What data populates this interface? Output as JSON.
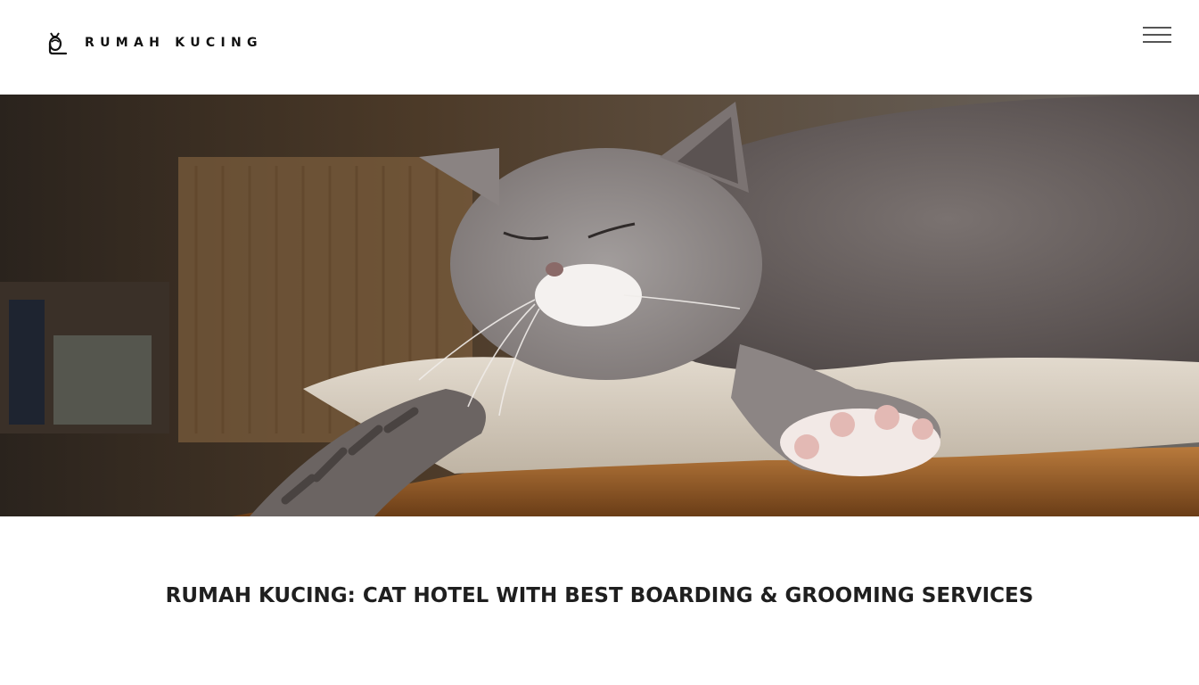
{
  "brand": {
    "name": "RUMAH KUCING",
    "logo_icon": "cat-logo-icon"
  },
  "nav": {
    "menu_icon": "hamburger-menu-icon"
  },
  "hero": {
    "image_subject": "grey-cat-sleeping-on-cushion"
  },
  "main": {
    "title": "RUMAH KUCING: CAT HOTEL WITH BEST BOARDING & GROOMING SERVICES"
  },
  "colors": {
    "text": "#1f1f1f",
    "background": "#ffffff",
    "menu_lines": "#555555"
  }
}
